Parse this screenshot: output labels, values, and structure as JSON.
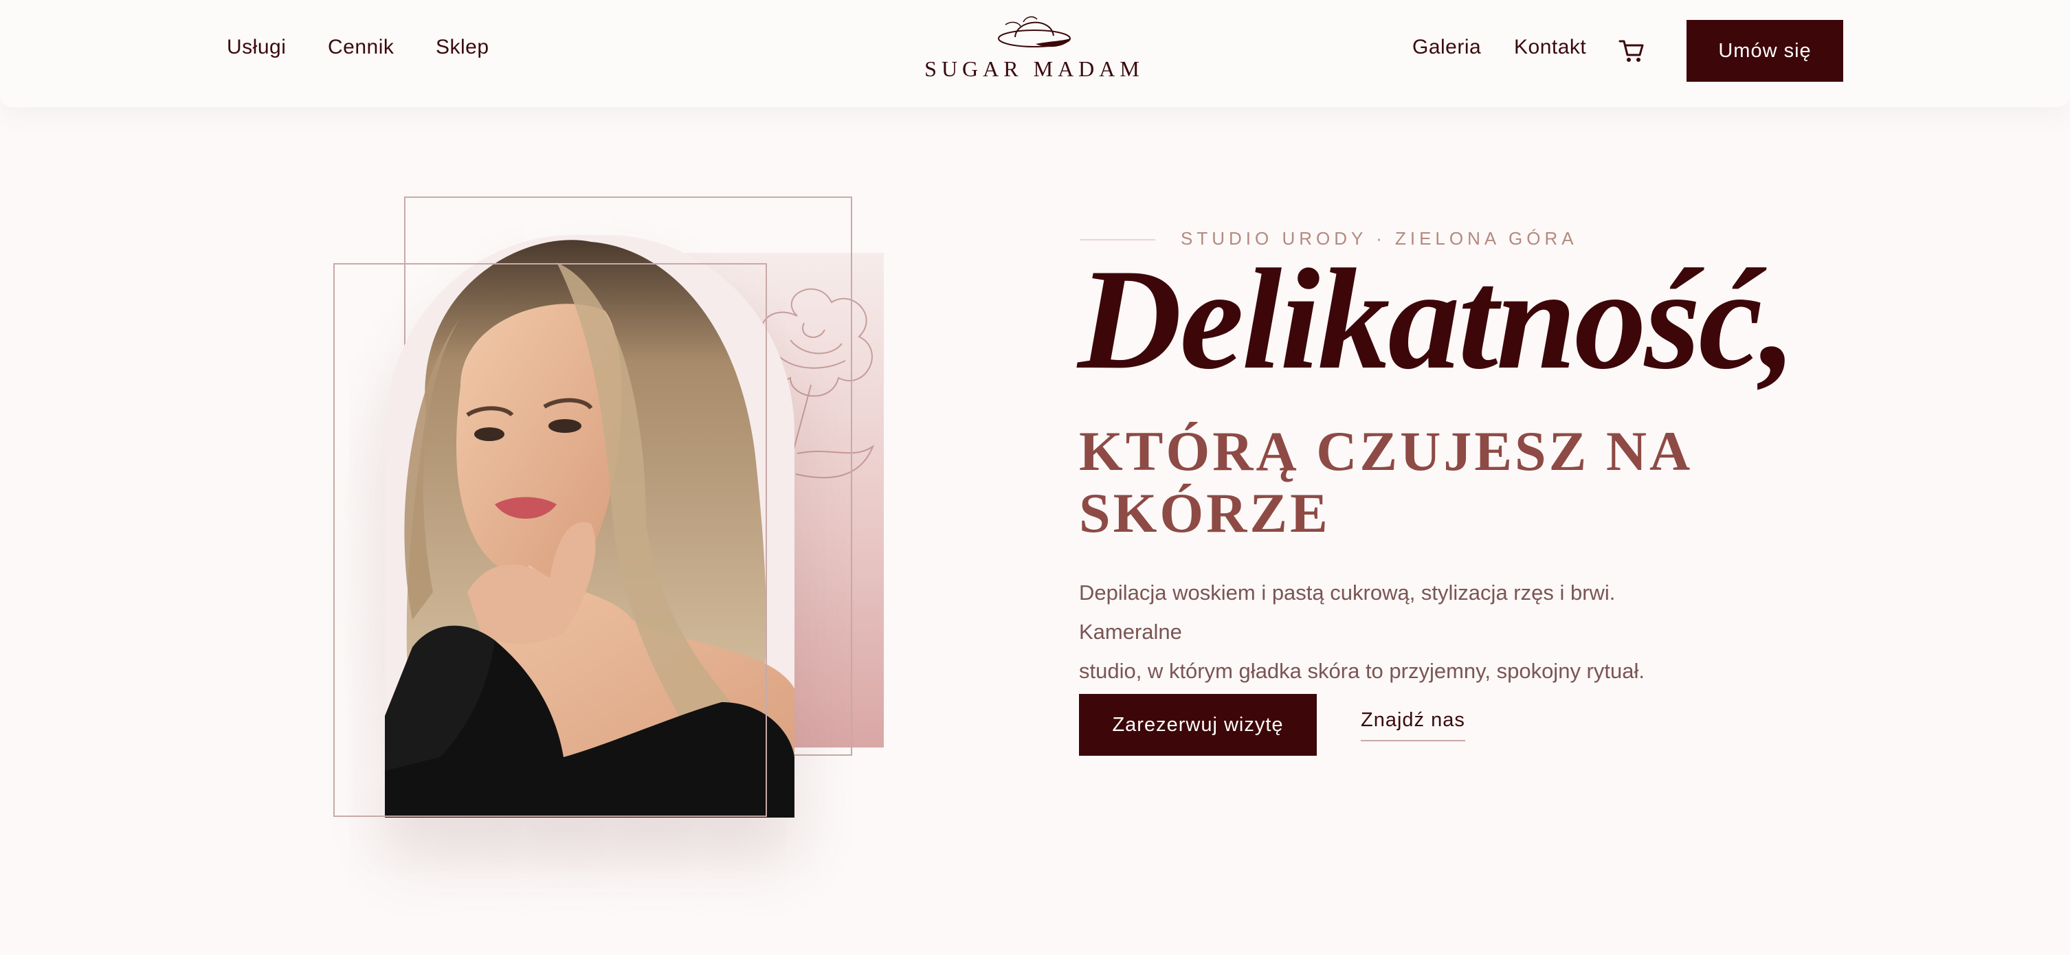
{
  "nav": {
    "left": [
      "Usługi",
      "Cennik",
      "Sklep"
    ],
    "right": [
      "Galeria",
      "Kontakt"
    ],
    "cart_icon": "cart-icon",
    "book_label": "Umów się"
  },
  "logo": {
    "text": "SUGAR MADAM",
    "icon": "hat-icon"
  },
  "hero": {
    "eyebrow": "STUDIO URODY · ZIELONA GÓRA",
    "script_title": "Delikatność,",
    "title_line1": "KTÓRĄ CZUJESZ NA",
    "title_line2": "SKÓRZE",
    "description_line1": "Depilacja woskiem i pastą cukrową, stylizacja rzęs i brwi. Kameralne",
    "description_line2": "studio, w którym gładka skóra to przyjemny, spokojny rytuał.",
    "cta_primary": "Zarezerwuj wizytę",
    "cta_secondary": "Znajdź nas"
  },
  "colors": {
    "accent": "#3d0709",
    "title_rose": "#8e4a45",
    "eyebrow": "#b4897f",
    "background": "#fcf9f8"
  }
}
